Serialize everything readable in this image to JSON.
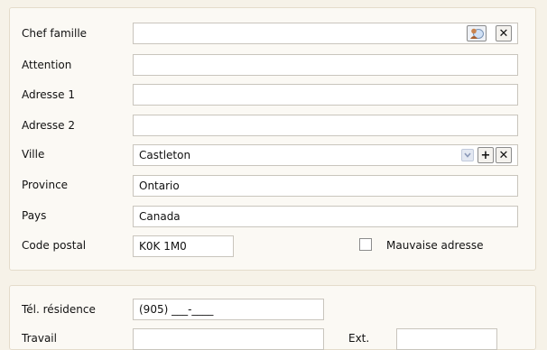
{
  "address_form": {
    "labels": {
      "head_of_family": "Chef famille",
      "attention": "Attention",
      "address1": "Adresse 1",
      "address2": "Adresse 2",
      "city": "Ville",
      "province": "Province",
      "country": "Pays",
      "postal_code": "Code postal"
    },
    "values": {
      "head_of_family": "",
      "attention": "",
      "address1": "",
      "address2": "",
      "city": "Castleton",
      "province": "Ontario",
      "country": "Canada",
      "postal_code": "K0K 1M0"
    },
    "bad_address": {
      "label": "Mauvaise adresse",
      "checked": false
    },
    "icons": {
      "lookup": "person-lookup-icon",
      "clear": "close-icon",
      "add": "plus-icon",
      "dropdown": "chevron-down-icon"
    }
  },
  "phone_form": {
    "labels": {
      "home": "Tél. résidence",
      "work": "Travail",
      "ext": "Ext."
    },
    "values": {
      "home": "(905) ___-____",
      "work": "",
      "ext": ""
    }
  }
}
